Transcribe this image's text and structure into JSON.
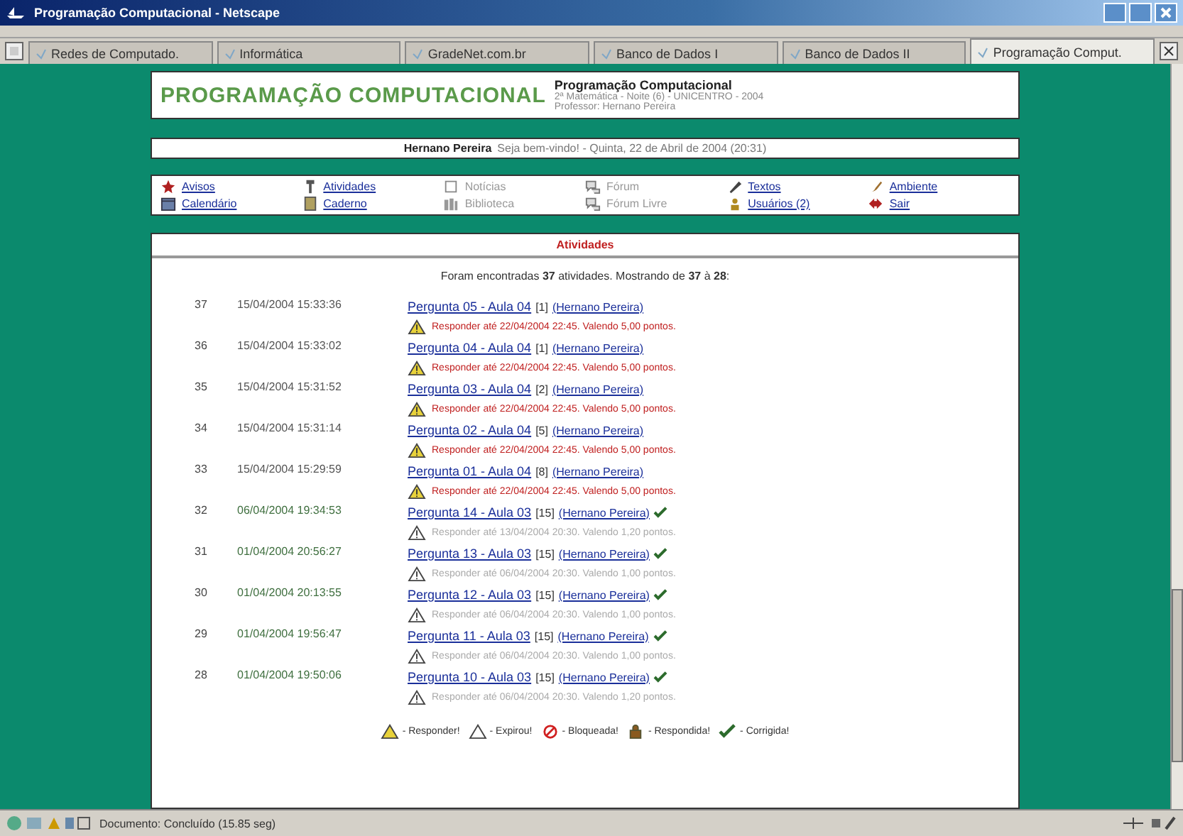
{
  "window": {
    "title": "Programação Computacional - Netscape"
  },
  "tabs": [
    {
      "label": "Redes de Computado.",
      "selected": false
    },
    {
      "label": "Informática",
      "selected": false
    },
    {
      "label": "GradeNet.com.br",
      "selected": false
    },
    {
      "label": "Banco de Dados I",
      "selected": false
    },
    {
      "label": "Banco de Dados II",
      "selected": false
    },
    {
      "label": "Programação Comput.",
      "selected": true
    }
  ],
  "header": {
    "logo": "PROGRAMAÇÃO COMPUTACIONAL",
    "title": "Programação Computacional",
    "line_1": "2ª Matemática - Noite (6) - UNICENTRO - 2004",
    "line_2": "Professor: Hernano Pereira"
  },
  "welcome": {
    "name": "Hernano Pereira",
    "text": "Seja bem-vindo! - Quinta, 22 de Abril de 2004 (20:31)"
  },
  "menu": [
    {
      "label": "Avisos",
      "enabled": true
    },
    {
      "label": "Atividades",
      "enabled": true
    },
    {
      "label": "Notícias",
      "enabled": false
    },
    {
      "label": "Fórum",
      "enabled": false
    },
    {
      "label": "Textos",
      "enabled": true
    },
    {
      "label": "Ambiente",
      "enabled": true
    },
    {
      "label": "Calendário",
      "enabled": true
    },
    {
      "label": "Caderno",
      "enabled": true
    },
    {
      "label": "Biblioteca",
      "enabled": false
    },
    {
      "label": "Fórum Livre",
      "enabled": false
    },
    {
      "label": "Usuários (2)",
      "enabled": true
    },
    {
      "label": "Sair",
      "enabled": true
    }
  ],
  "panel": {
    "title": "Atividades",
    "summary": "Foram encontradas **37** atividades. Mostrando de **37** à **28**:"
  },
  "activities": [
    {
      "number": "37",
      "date": "15/04/2004 15:33:36",
      "title": "Pergunta 05 - Aula 04",
      "count": "[1]",
      "author": "(Hernano Pereira)",
      "kind": "open",
      "corrected": false,
      "note": "Responder até 22/04/2004 22:45. Valendo 5,00 pontos."
    },
    {
      "number": "36",
      "date": "15/04/2004 15:33:02",
      "title": "Pergunta 04 - Aula 04",
      "count": "[1]",
      "author": "(Hernano Pereira)",
      "kind": "open",
      "corrected": false,
      "note": "Responder até 22/04/2004 22:45. Valendo 5,00 pontos."
    },
    {
      "number": "35",
      "date": "15/04/2004 15:31:52",
      "title": "Pergunta 03 - Aula 04",
      "count": "[2]",
      "author": "(Hernano Pereira)",
      "kind": "open",
      "corrected": false,
      "note": "Responder até 22/04/2004 22:45. Valendo 5,00 pontos."
    },
    {
      "number": "34",
      "date": "15/04/2004 15:31:14",
      "title": "Pergunta 02 - Aula 04",
      "count": "[5]",
      "author": "(Hernano Pereira)",
      "kind": "open",
      "corrected": false,
      "note": "Responder até 22/04/2004 22:45. Valendo 5,00 pontos."
    },
    {
      "number": "33",
      "date": "15/04/2004 15:29:59",
      "title": "Pergunta 01 - Aula 04",
      "count": "[8]",
      "author": "(Hernano Pereira)",
      "kind": "open",
      "corrected": false,
      "note": "Responder até 22/04/2004 22:45. Valendo 5,00 pontos."
    },
    {
      "number": "32",
      "date": "06/04/2004 19:34:53",
      "title": "Pergunta 14 - Aula 03",
      "count": "[15]",
      "author": "(Hernano Pereira)",
      "kind": "expired",
      "corrected": true,
      "note": "Responder até 13/04/2004 20:30. Valendo 1,20 pontos."
    },
    {
      "number": "31",
      "date": "01/04/2004 20:56:27",
      "title": "Pergunta 13 - Aula 03",
      "count": "[15]",
      "author": "(Hernano Pereira)",
      "kind": "expired",
      "corrected": true,
      "note": "Responder até 06/04/2004 20:30. Valendo 1,00 pontos."
    },
    {
      "number": "30",
      "date": "01/04/2004 20:13:55",
      "title": "Pergunta 12 - Aula 03",
      "count": "[15]",
      "author": "(Hernano Pereira)",
      "kind": "expired",
      "corrected": true,
      "note": "Responder até 06/04/2004 20:30. Valendo 1,00 pontos."
    },
    {
      "number": "29",
      "date": "01/04/2004 19:56:47",
      "title": "Pergunta 11 - Aula 03",
      "count": "[15]",
      "author": "(Hernano Pereira)",
      "kind": "expired",
      "corrected": true,
      "note": "Responder até 06/04/2004 20:30. Valendo 1,00 pontos."
    },
    {
      "number": "28",
      "date": "01/04/2004 19:50:06",
      "title": "Pergunta 10 - Aula 03",
      "count": "[15]",
      "author": "(Hernano Pereira)",
      "kind": "expired",
      "corrected": true,
      "note": "Responder até 06/04/2004 20:30. Valendo 1,20 pontos."
    }
  ],
  "legend": [
    {
      "kind": "open",
      "label": "- Responder!"
    },
    {
      "kind": "expired",
      "label": "- Expirou!"
    },
    {
      "kind": "blocked",
      "label": "- Bloqueada!"
    },
    {
      "kind": "answered",
      "label": "- Respondida!"
    },
    {
      "kind": "corrected",
      "label": "- Corrigida!"
    }
  ],
  "status_bar": {
    "text": "Documento: Concluído (15.85 seg)"
  }
}
